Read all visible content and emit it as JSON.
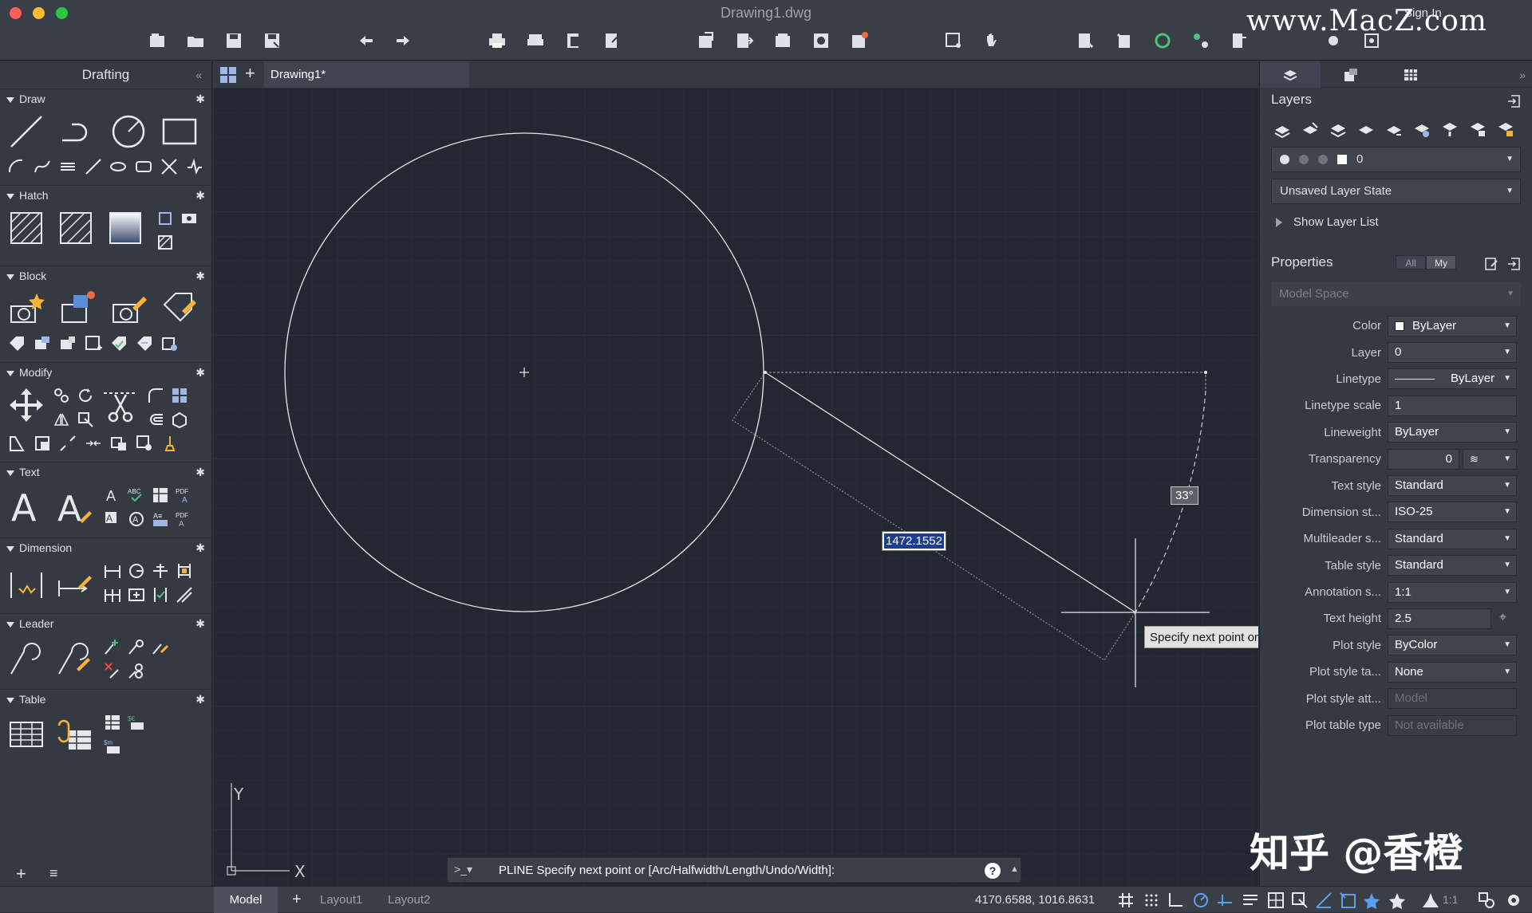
{
  "window": {
    "title": "Drawing1.dwg",
    "sign_in": "Sign In",
    "watermark_top": "www.MacZ.com"
  },
  "left_panel": {
    "title": "Drafting",
    "sections": {
      "draw": "Draw",
      "hatch": "Hatch",
      "block": "Block",
      "modify": "Modify",
      "text": "Text",
      "dimension": "Dimension",
      "leader": "Leader",
      "table": "Table"
    }
  },
  "doc_tab": {
    "label": "Drawing1*"
  },
  "canvas": {
    "dimension_value": "1472.1552",
    "angle_value": "33°",
    "tooltip": "Specify next point or",
    "axis_y": "Y",
    "axis_x": "X"
  },
  "command_line": {
    "prompt": ">_▾",
    "text": "PLINE Specify next point or [Arc/Halfwidth/Length/Undo/Width]:",
    "help": "?"
  },
  "right_panel": {
    "layers": {
      "title": "Layers",
      "current_layer": "0",
      "layer_state": "Unsaved Layer State",
      "show_layer_list": "Show Layer List"
    },
    "properties": {
      "title": "Properties",
      "filter_all": "All",
      "filter_my": "My",
      "space": "Model Space",
      "rows": [
        {
          "label": "Color",
          "value": "ByLayer"
        },
        {
          "label": "Layer",
          "value": "0"
        },
        {
          "label": "Linetype",
          "value": "ByLayer"
        },
        {
          "label": "Linetype scale",
          "value": "1"
        },
        {
          "label": "Lineweight",
          "value": "ByLayer"
        },
        {
          "label": "Transparency",
          "value": "0"
        },
        {
          "label": "Text style",
          "value": "Standard"
        },
        {
          "label": "Dimension st...",
          "value": "ISO-25"
        },
        {
          "label": "Multileader s...",
          "value": "Standard"
        },
        {
          "label": "Table style",
          "value": "Standard"
        },
        {
          "label": "Annotation s...",
          "value": "1:1"
        },
        {
          "label": "Text height",
          "value": "2.5"
        },
        {
          "label": "Plot style",
          "value": "ByColor"
        },
        {
          "label": "Plot style ta...",
          "value": "None"
        },
        {
          "label": "Plot style att...",
          "value": "Model"
        },
        {
          "label": "Plot table type",
          "value": "Not available"
        }
      ]
    }
  },
  "status_bar": {
    "tabs": {
      "model": "Model",
      "layout1": "Layout1",
      "layout2": "Layout2"
    },
    "coordinates": "4170.6588, 1016.8631",
    "annotation_scale": "1:1"
  },
  "watermark_bottom": "知乎 @香橙"
}
